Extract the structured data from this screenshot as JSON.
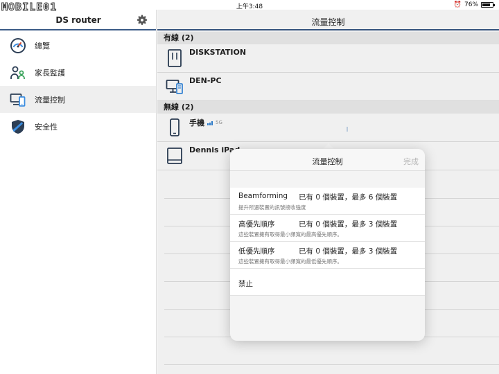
{
  "watermark": "MOBILE01",
  "status_bar": {
    "time": "上午3:48",
    "battery": "76%",
    "battery_level": 0.76
  },
  "sidebar": {
    "title": "DS router",
    "items": [
      {
        "label": "總覽",
        "icon": "gauge-icon"
      },
      {
        "label": "家長監護",
        "icon": "parental-users-icon"
      },
      {
        "label": "流量控制",
        "icon": "traffic-devices-icon"
      },
      {
        "label": "安全性",
        "icon": "shield-icon"
      }
    ],
    "active_index": 2
  },
  "main": {
    "title": "流量控制",
    "sections": [
      {
        "header": "有線 (2)",
        "devices": [
          {
            "name": "DISKSTATION",
            "icon": "nas-icon"
          },
          {
            "name": "DEN-PC",
            "icon": "desktop-icon"
          }
        ]
      },
      {
        "header": "無線 (2)",
        "devices": [
          {
            "name": "手機",
            "icon": "phone-icon",
            "band": "5G"
          },
          {
            "name": "Dennis iPad",
            "icon": "tablet-icon"
          }
        ]
      }
    ]
  },
  "popover": {
    "title": "流量控制",
    "done": "完成",
    "options": [
      {
        "label": "Beamforming",
        "status": "已有 0 個裝置，最多 6 個裝置",
        "desc": "提升所選裝置的訊號接收強度"
      },
      {
        "label": "高優先順序",
        "status": "已有 0 個裝置，最多 3 個裝置",
        "desc": "這些裝置擁有取得最小頻寬的最高優先順序。"
      },
      {
        "label": "低優先順序",
        "status": "已有 0 個裝置，最多 3 個裝置",
        "desc": "這些裝置擁有取得最小頻寬的最低優先順序。"
      },
      {
        "label": "禁止"
      }
    ]
  },
  "colors": {
    "accent": "#3a5a86",
    "wifi": "#2a7fd4",
    "icon": "#2c3e55"
  }
}
